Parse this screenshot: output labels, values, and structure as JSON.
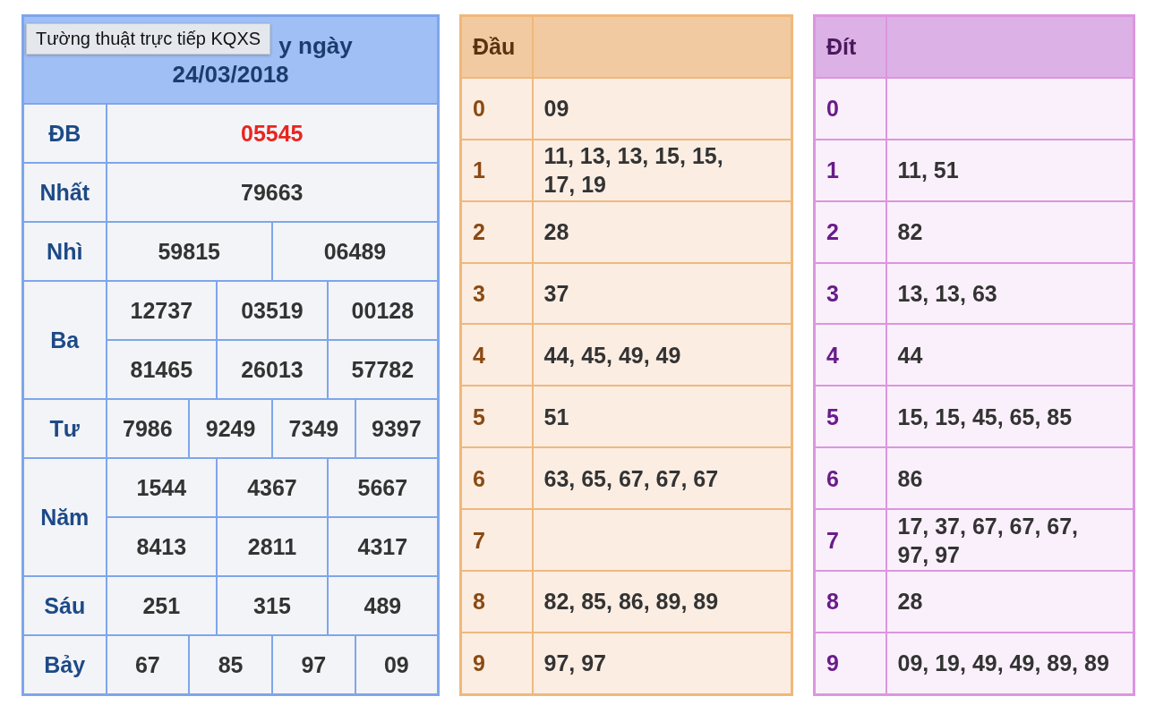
{
  "tooltip": "Tường thuật trực tiếp KQXS",
  "results": {
    "title": "y ngày",
    "date": "24/03/2018",
    "prizes": [
      {
        "name": "ĐB",
        "special": true,
        "rows": [
          [
            "05545"
          ]
        ]
      },
      {
        "name": "Nhất",
        "special": false,
        "rows": [
          [
            "79663"
          ]
        ]
      },
      {
        "name": "Nhì",
        "special": false,
        "rows": [
          [
            "59815",
            "06489"
          ]
        ]
      },
      {
        "name": "Ba",
        "special": false,
        "rows": [
          [
            "12737",
            "03519",
            "00128"
          ],
          [
            "81465",
            "26013",
            "57782"
          ]
        ]
      },
      {
        "name": "Tư",
        "special": false,
        "rows": [
          [
            "7986",
            "9249",
            "7349",
            "9397"
          ]
        ]
      },
      {
        "name": "Năm",
        "special": false,
        "rows": [
          [
            "1544",
            "4367",
            "5667"
          ],
          [
            "8413",
            "2811",
            "4317"
          ]
        ]
      },
      {
        "name": "Sáu",
        "special": false,
        "rows": [
          [
            "251",
            "315",
            "489"
          ]
        ]
      },
      {
        "name": "Bảy",
        "special": false,
        "rows": [
          [
            "67",
            "85",
            "97",
            "09"
          ]
        ]
      }
    ]
  },
  "dau": {
    "header": "Đầu",
    "rows": [
      {
        "digit": "0",
        "values": "09"
      },
      {
        "digit": "1",
        "values": "11, 13, 13, 15, 15, 17, 19"
      },
      {
        "digit": "2",
        "values": "28"
      },
      {
        "digit": "3",
        "values": "37"
      },
      {
        "digit": "4",
        "values": "44, 45, 49, 49"
      },
      {
        "digit": "5",
        "values": "51"
      },
      {
        "digit": "6",
        "values": "63, 65, 67, 67, 67"
      },
      {
        "digit": "7",
        "values": ""
      },
      {
        "digit": "8",
        "values": "82, 85, 86, 89, 89"
      },
      {
        "digit": "9",
        "values": "97, 97"
      }
    ]
  },
  "dit": {
    "header": "Đít",
    "rows": [
      {
        "digit": "0",
        "values": ""
      },
      {
        "digit": "1",
        "values": "11, 51"
      },
      {
        "digit": "2",
        "values": "82"
      },
      {
        "digit": "3",
        "values": "13, 13, 63"
      },
      {
        "digit": "4",
        "values": "44"
      },
      {
        "digit": "5",
        "values": "15, 15, 45, 65, 85"
      },
      {
        "digit": "6",
        "values": "86"
      },
      {
        "digit": "7",
        "values": "17, 37, 67, 67, 67, 97, 97"
      },
      {
        "digit": "8",
        "values": "28"
      },
      {
        "digit": "9",
        "values": "09, 19, 49, 49, 89, 89"
      }
    ]
  }
}
